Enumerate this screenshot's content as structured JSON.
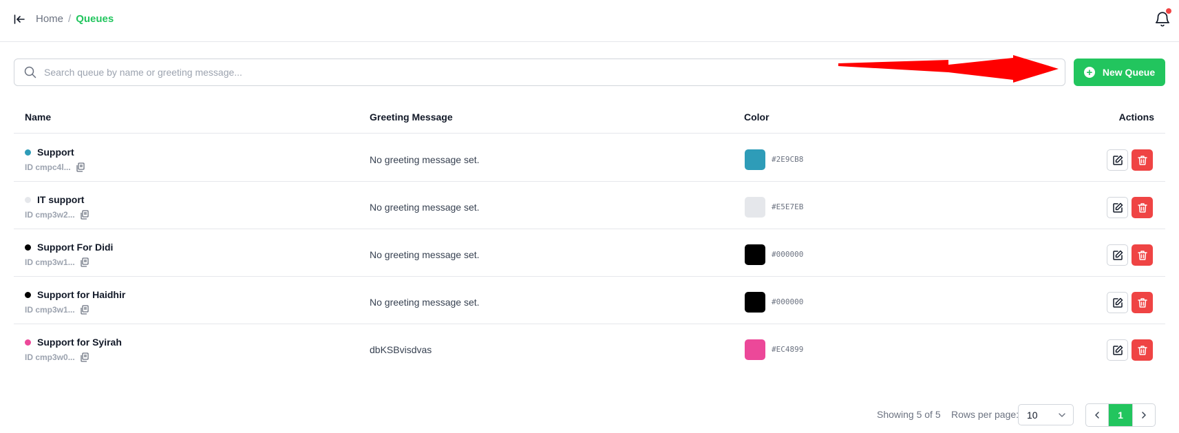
{
  "breadcrumb": {
    "home": "Home",
    "separator": "/",
    "current": "Queues"
  },
  "search": {
    "placeholder": "Search queue by name or greeting message...",
    "value": ""
  },
  "new_queue_button": {
    "label": "New Queue",
    "icon": "plus-circle-icon"
  },
  "table": {
    "headers": {
      "name": "Name",
      "greeting": "Greeting Message",
      "color": "Color",
      "actions": "Actions"
    },
    "rows": [
      {
        "name": "Support",
        "id": "ID cmpc4l...",
        "greeting": "No greeting message set.",
        "color": "#2E9CB8",
        "hex": "#2E9CB8"
      },
      {
        "name": "IT support",
        "id": "ID cmp3w2...",
        "greeting": "No greeting message set.",
        "color": "#E5E7EB",
        "hex": "#E5E7EB"
      },
      {
        "name": "Support For Didi",
        "id": "ID cmp3w1...",
        "greeting": "No greeting message set.",
        "color": "#000000",
        "hex": "#000000"
      },
      {
        "name": "Support for Haidhir",
        "id": "ID cmp3w1...",
        "greeting": "No greeting message set.",
        "color": "#000000",
        "hex": "#000000"
      },
      {
        "name": "Support for Syirah",
        "id": "ID cmp3w0...",
        "greeting": "dbKSBvisdvas",
        "color": "#EC4899",
        "hex": "#EC4899"
      }
    ]
  },
  "footer": {
    "showing": "Showing 5 of 5",
    "rows_per_page_label": "Rows per page:",
    "rows_per_page_value": "10",
    "current_page": "1"
  },
  "colors": {
    "accent": "#22c55e",
    "danger": "#ef4444",
    "annotation_arrow": "#ff0000"
  }
}
